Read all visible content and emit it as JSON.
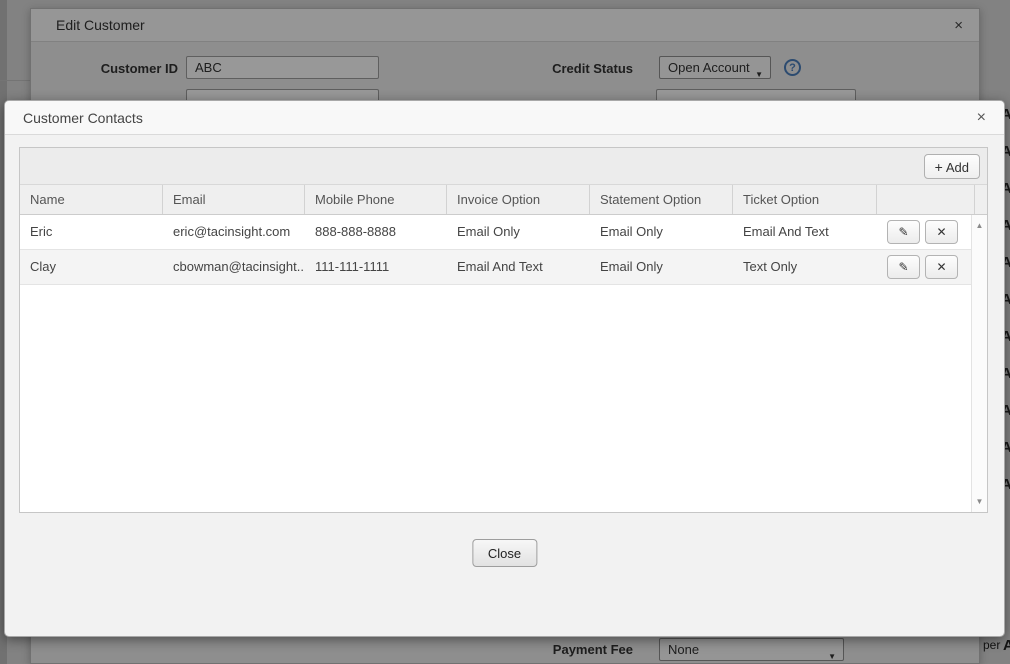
{
  "background": {
    "edit_customer": {
      "title": "Edit Customer",
      "close_icon": "×",
      "fields": {
        "customer_id": {
          "label": "Customer ID",
          "value": "ABC"
        },
        "credit_status": {
          "label": "Credit Status",
          "value": "Open Account"
        },
        "payment_fee": {
          "label": "Payment Fee",
          "value": "None"
        }
      },
      "dropdown_caret": "▼",
      "help_icon": "?",
      "edge_letters": [
        "A",
        "A",
        "A",
        "A",
        "A",
        "A",
        "A",
        "A",
        "A",
        "A",
        "A"
      ],
      "clipped_fragment": "per",
      "clipped_letter": "A"
    }
  },
  "dialog": {
    "title": "Customer Contacts",
    "close_icon": "×",
    "toolbar": {
      "add_plus": "+",
      "add_label": "Add"
    },
    "table": {
      "columns": [
        "Name",
        "Email",
        "Mobile Phone",
        "Invoice Option",
        "Statement Option",
        "Ticket Option"
      ],
      "rows": [
        {
          "name": "Eric",
          "email": "eric@tacinsight.com",
          "mobile": "888-888-8888",
          "invoice": "Email Only",
          "statement": "Email Only",
          "ticket": "Email And Text"
        },
        {
          "name": "Clay",
          "email": "cbowman@tacinsight...",
          "mobile": "111-111-1111",
          "invoice": "Email And Text",
          "statement": "Email Only",
          "ticket": "Text Only"
        }
      ],
      "edit_icon": "✎",
      "delete_icon": "✕",
      "scroll_up_icon": "▲",
      "scroll_down_icon": "▼"
    },
    "close_button": "Close"
  },
  "colors": {
    "overlay": "rgba(0,0,0,0.40)",
    "dialog_bg": "#f2f2f2",
    "help_accent": "#4a7ebb",
    "row_alt": "#f4f4f4"
  }
}
